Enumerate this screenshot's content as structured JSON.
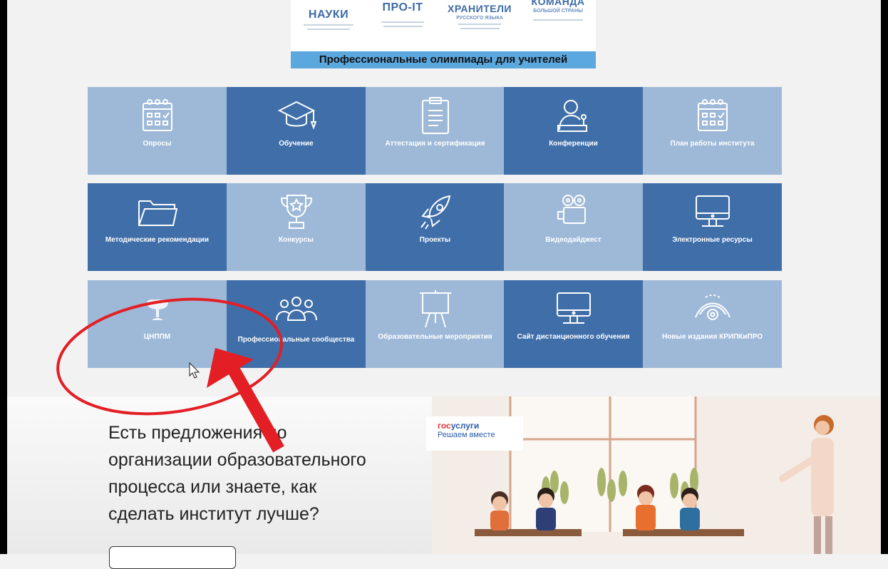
{
  "banner": {
    "logos": [
      {
        "title": "НАУКИ"
      },
      {
        "title": "ПРО-IT"
      },
      {
        "title": "ХРАНИТЕЛИ",
        "subtitle": "РУССКОГО ЯЗЫКА"
      },
      {
        "title": "КОМАНДА",
        "subtitle": "БОЛЬШОЙ СТРАНЫ"
      }
    ],
    "strip_text": "Профессиональные олимпиады для учителей"
  },
  "tiles": [
    {
      "label": "Опросы",
      "icon": "calendar-icon"
    },
    {
      "label": "Обучение",
      "icon": "graduation-cap-icon"
    },
    {
      "label": "Аттестация и сертификация",
      "icon": "clipboard-icon"
    },
    {
      "label": "Конференции",
      "icon": "speaker-icon"
    },
    {
      "label": "План работы института",
      "icon": "calendar-icon"
    },
    {
      "label": "Методические рекомендации",
      "icon": "folder-icon"
    },
    {
      "label": "Конкурсы",
      "icon": "trophy-icon"
    },
    {
      "label": "Проекты",
      "icon": "rocket-icon"
    },
    {
      "label": "Видеодайджест",
      "icon": "video-camera-icon"
    },
    {
      "label": "Электронные ресурсы",
      "icon": "monitor-icon"
    },
    {
      "label": "ЦНППМ",
      "icon": "tree-icon"
    },
    {
      "label": "Профессиональные сообщества",
      "icon": "people-icon"
    },
    {
      "label": "Образовательные мероприятия",
      "icon": "easel-icon"
    },
    {
      "label": "Сайт дистанционного обучения",
      "icon": "monitor-icon"
    },
    {
      "label": "Новые издания КРИПКиПРО",
      "icon": "eye-icon"
    }
  ],
  "cta": {
    "lines": [
      "Есть предложения по",
      "организации образовательного",
      "процесса или знаете, как",
      "сделать институт лучше?"
    ]
  },
  "gosuslugi": {
    "brand_red": "гос",
    "brand_blue": "услуги",
    "subtitle": "Решаем вместе"
  },
  "colors": {
    "tile_light": "#9eb9d8",
    "tile_dark": "#3f6ea9",
    "annotation": "#e31e24"
  }
}
